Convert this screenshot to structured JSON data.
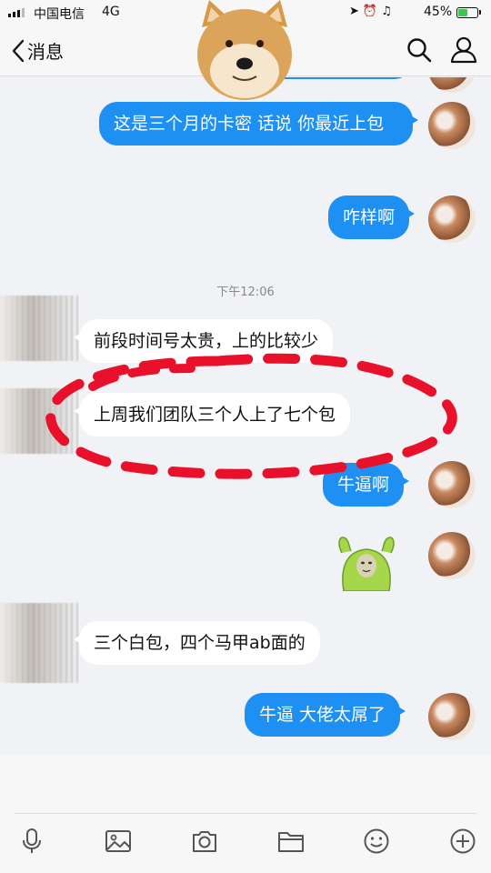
{
  "status_bar": {
    "carrier": "中国电信",
    "network": "4G",
    "battery_percent": "45%",
    "battery_level": 0.45,
    "signal_bars_on": 3,
    "icons": [
      "location-icon",
      "alarm-icon",
      "headphones-icon"
    ]
  },
  "nav": {
    "back_label": "消息",
    "icons": [
      "search-icon",
      "profile-icon"
    ]
  },
  "timestamp": "下午12:06",
  "messages": [
    {
      "direction": "out",
      "text": "这是三个月的卡密  话说 你最近上包"
    },
    {
      "direction": "out",
      "text": "咋样啊"
    },
    {
      "direction": "in",
      "text": "前段时间号太贵，上的比较少"
    },
    {
      "direction": "in",
      "text": "上周我们团队三个人上了七个包"
    },
    {
      "direction": "out",
      "text": "牛逼啊"
    },
    {
      "direction": "out",
      "sticker": "green-cartoon-sticker"
    },
    {
      "direction": "in",
      "text": "三个白包，四个马甲ab面的"
    },
    {
      "direction": "out",
      "text": "牛逼 大佬太屌了"
    }
  ],
  "toolbar": [
    "microphone-icon",
    "image-icon",
    "camera-icon",
    "folder-icon",
    "emoji-icon",
    "plus-icon"
  ],
  "colors": {
    "outgoing_bubble": "#1e8ff3",
    "incoming_bubble": "#ffffff",
    "annotation_red": "#e8102a",
    "background": "#f0f2f5"
  }
}
